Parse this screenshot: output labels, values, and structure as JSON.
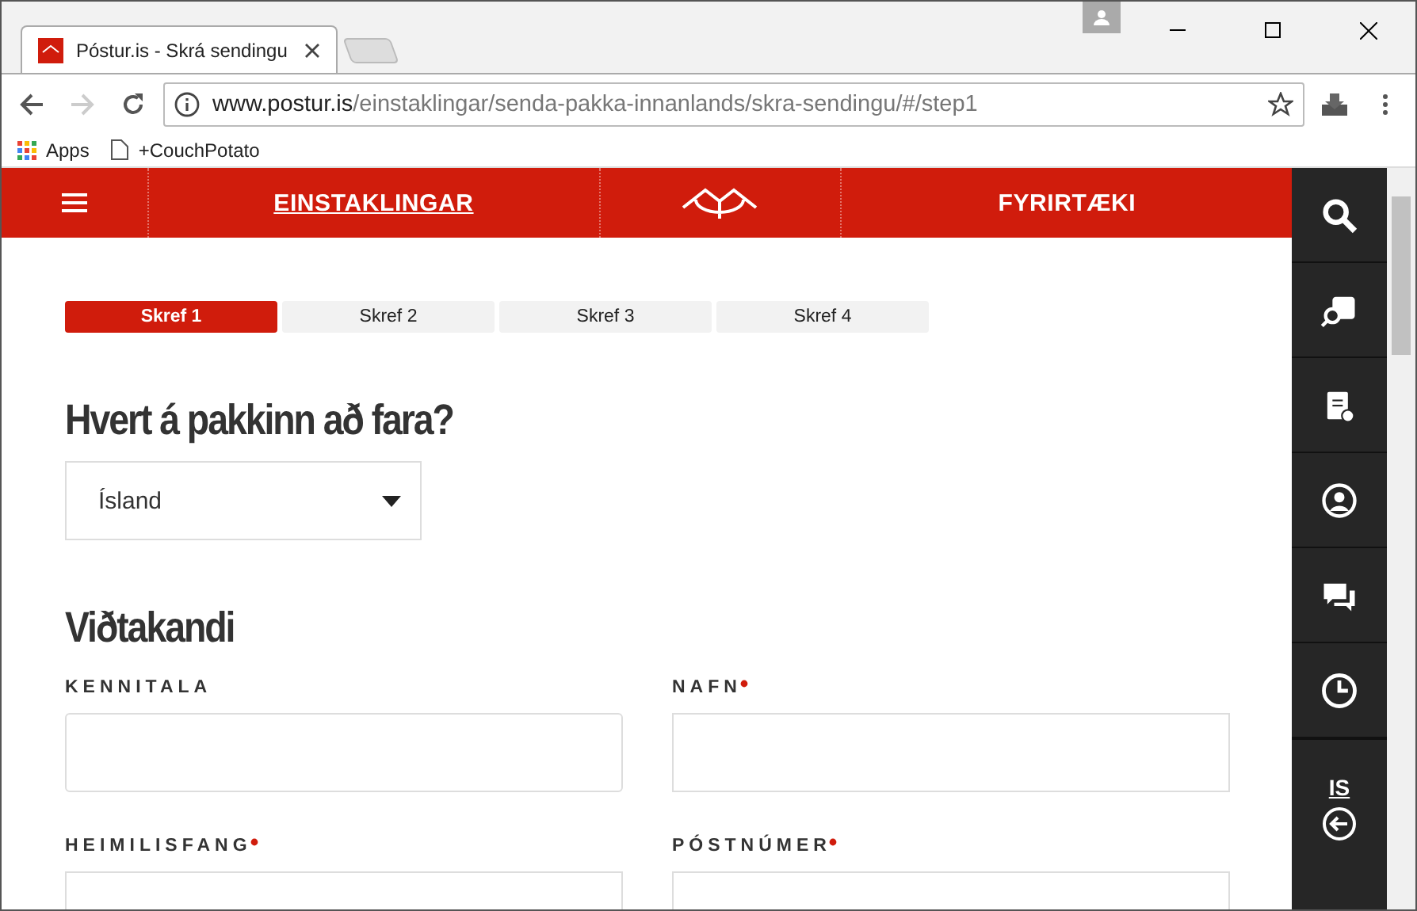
{
  "browser": {
    "tab_title": "Póstur.is - Skrá sendingu",
    "url_host": "www.postur.is",
    "url_path": "/einstaklingar/senda-pakka-innanlands/skra-sendingu/#/step1",
    "bookmarks": [
      {
        "kind": "apps",
        "label": "Apps"
      },
      {
        "kind": "page",
        "label": "+CouchPotato"
      }
    ]
  },
  "nav": {
    "items": [
      {
        "label": "EINSTAKLINGAR",
        "selected": true
      },
      {
        "label": "FYRIRTÆKI",
        "selected": false
      }
    ]
  },
  "steps": [
    {
      "label": "Skref 1",
      "selected": true
    },
    {
      "label": "Skref 2",
      "selected": false
    },
    {
      "label": "Skref 3",
      "selected": false
    },
    {
      "label": "Skref 4",
      "selected": false
    }
  ],
  "destination": {
    "heading": "Hvert á pakkinn að fara?",
    "value": "Ísland"
  },
  "recipient": {
    "heading": "Viðtakandi",
    "fields": [
      {
        "label": "KENNITALA",
        "required": false
      },
      {
        "label": "NAFN",
        "required": true
      },
      {
        "label": "HEIMILISFANG",
        "required": true
      },
      {
        "label": "PÓSTNÚMER",
        "required": true
      }
    ]
  },
  "sidebar": {
    "items": [
      {
        "kind": "search"
      },
      {
        "kind": "track"
      },
      {
        "kind": "clipboard"
      },
      {
        "kind": "user"
      },
      {
        "kind": "chat"
      },
      {
        "kind": "clock"
      }
    ],
    "language": "IS"
  }
}
